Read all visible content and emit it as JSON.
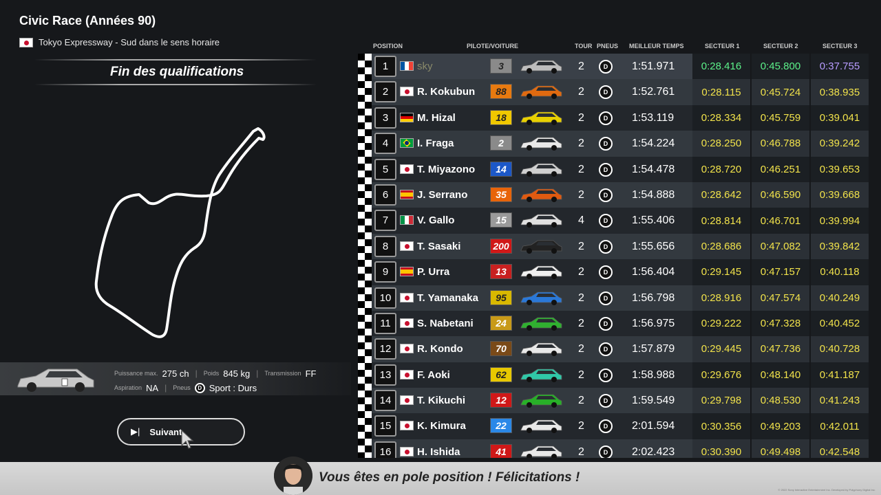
{
  "race": {
    "title": "Civic Race (Années 90)",
    "track": "Tokyo Expressway - Sud dans le sens horaire",
    "session": "Fin des qualifications"
  },
  "car_specs": {
    "power_label": "Puissance max.",
    "power_value": "275 ch",
    "weight_label": "Poids",
    "weight_value": "845 kg",
    "transmission_label": "Transmission",
    "transmission_value": "FF",
    "aspiration_label": "Aspiration",
    "aspiration_value": "NA",
    "tyres_label": "Pneus",
    "tyres_icon_letter": "D",
    "tyres_value": "Sport : Durs"
  },
  "next_button": {
    "icon": "▶|",
    "label": "Suivant"
  },
  "table": {
    "headers": {
      "position": "POSITION",
      "driver": "PILOTE/VOITURE",
      "lap": "TOUR",
      "tyres": "PNEUS",
      "best": "MEILLEUR TEMPS",
      "s1": "SECTEUR 1",
      "s2": "SECTEUR 2",
      "s3": "SECTEUR 3"
    },
    "rows": [
      {
        "pos": "1",
        "flag": "fr",
        "driver": "sky",
        "num": "3",
        "num_bg": "#8a8a8a",
        "num_fg": "#222",
        "car_color": "#bdbdbd",
        "lap": "2",
        "tyre": "D",
        "best": "1:51.971",
        "s1": "0:28.416",
        "s2": "0:45.800",
        "s3": "0:37.755",
        "s1c": "#5cf28a",
        "s2c": "#5cf28a",
        "s3c": "#b89cff",
        "me": true
      },
      {
        "pos": "2",
        "flag": "jp",
        "driver": "R. Kokubun",
        "num": "88",
        "num_bg": "#e87a10",
        "num_fg": "#222",
        "car_color": "#e06a10",
        "lap": "2",
        "tyre": "D",
        "best": "1:52.761",
        "s1": "0:28.115",
        "s2": "0:45.724",
        "s3": "0:38.935"
      },
      {
        "pos": "3",
        "flag": "de",
        "driver": "M. Hizal",
        "num": "18",
        "num_bg": "#f0c800",
        "num_fg": "#222",
        "car_color": "#e8d000",
        "lap": "2",
        "tyre": "D",
        "best": "1:53.119",
        "s1": "0:28.334",
        "s2": "0:45.759",
        "s3": "0:39.041"
      },
      {
        "pos": "4",
        "flag": "br",
        "driver": "I. Fraga",
        "num": "2",
        "num_bg": "#8a8a8a",
        "num_fg": "#fff",
        "car_color": "#e8e8e8",
        "lap": "2",
        "tyre": "D",
        "best": "1:54.224",
        "s1": "0:28.250",
        "s2": "0:46.788",
        "s3": "0:39.242"
      },
      {
        "pos": "5",
        "flag": "jp",
        "driver": "T. Miyazono",
        "num": "14",
        "num_bg": "#1c58c8",
        "num_fg": "#fff",
        "car_color": "#d0d0d0",
        "lap": "2",
        "tyre": "D",
        "best": "1:54.478",
        "s1": "0:28.720",
        "s2": "0:46.251",
        "s3": "0:39.653"
      },
      {
        "pos": "6",
        "flag": "es",
        "driver": "J. Serrano",
        "num": "35",
        "num_bg": "#e8640a",
        "num_fg": "#fff",
        "car_color": "#e05a10",
        "lap": "2",
        "tyre": "D",
        "best": "1:54.888",
        "s1": "0:28.642",
        "s2": "0:46.590",
        "s3": "0:39.668"
      },
      {
        "pos": "7",
        "flag": "it",
        "driver": "V. Gallo",
        "num": "15",
        "num_bg": "#9a9a9a",
        "num_fg": "#fff",
        "car_color": "#e0e0e0",
        "lap": "4",
        "tyre": "D",
        "best": "1:55.406",
        "s1": "0:28.814",
        "s2": "0:46.701",
        "s3": "0:39.994"
      },
      {
        "pos": "8",
        "flag": "jp",
        "driver": "T. Sasaki",
        "num": "200",
        "num_bg": "#d01818",
        "num_fg": "#fff",
        "car_color": "#222222",
        "lap": "2",
        "tyre": "D",
        "best": "1:55.656",
        "s1": "0:28.686",
        "s2": "0:47.082",
        "s3": "0:39.842"
      },
      {
        "pos": "9",
        "flag": "es",
        "driver": "P. Urra",
        "num": "13",
        "num_bg": "#c82020",
        "num_fg": "#fff",
        "car_color": "#f0f0f0",
        "lap": "2",
        "tyre": "D",
        "best": "1:56.404",
        "s1": "0:29.145",
        "s2": "0:47.157",
        "s3": "0:40.118"
      },
      {
        "pos": "10",
        "flag": "jp",
        "driver": "T. Yamanaka",
        "num": "95",
        "num_bg": "#d8b800",
        "num_fg": "#222",
        "car_color": "#2a78d8",
        "lap": "2",
        "tyre": "D",
        "best": "1:56.798",
        "s1": "0:28.916",
        "s2": "0:47.574",
        "s3": "0:40.249"
      },
      {
        "pos": "11",
        "flag": "jp",
        "driver": "S. Nabetani",
        "num": "24",
        "num_bg": "#c89a18",
        "num_fg": "#fff",
        "car_color": "#30b030",
        "lap": "2",
        "tyre": "D",
        "best": "1:56.975",
        "s1": "0:29.222",
        "s2": "0:47.328",
        "s3": "0:40.452"
      },
      {
        "pos": "12",
        "flag": "jp",
        "driver": "R. Kondo",
        "num": "70",
        "num_bg": "#7a4a18",
        "num_fg": "#fff",
        "car_color": "#e8e8e8",
        "lap": "2",
        "tyre": "D",
        "best": "1:57.879",
        "s1": "0:29.445",
        "s2": "0:47.736",
        "s3": "0:40.728"
      },
      {
        "pos": "13",
        "flag": "jp",
        "driver": "F. Aoki",
        "num": "62",
        "num_bg": "#e8c800",
        "num_fg": "#222",
        "car_color": "#30c8a8",
        "lap": "2",
        "tyre": "D",
        "best": "1:58.988",
        "s1": "0:29.676",
        "s2": "0:48.140",
        "s3": "0:41.187"
      },
      {
        "pos": "14",
        "flag": "jp",
        "driver": "T. Kikuchi",
        "num": "12",
        "num_bg": "#d01818",
        "num_fg": "#fff",
        "car_color": "#28b028",
        "lap": "2",
        "tyre": "D",
        "best": "1:59.549",
        "s1": "0:29.798",
        "s2": "0:48.530",
        "s3": "0:41.243"
      },
      {
        "pos": "15",
        "flag": "jp",
        "driver": "K. Kimura",
        "num": "22",
        "num_bg": "#2a88e8",
        "num_fg": "#fff",
        "car_color": "#e8e8e8",
        "lap": "2",
        "tyre": "D",
        "best": "2:01.594",
        "s1": "0:30.356",
        "s2": "0:49.203",
        "s3": "0:42.011"
      },
      {
        "pos": "16",
        "flag": "jp",
        "driver": "H. Ishida",
        "num": "41",
        "num_bg": "#d01818",
        "num_fg": "#fff",
        "car_color": "#e8e8e8",
        "lap": "2",
        "tyre": "D",
        "best": "2:02.423",
        "s1": "0:30.390",
        "s2": "0:49.498",
        "s3": "0:42.548"
      }
    ]
  },
  "message": "Vous êtes en pole position ! Félicitations !",
  "copyright": "© 2022 Sony Interactive Entertainment Inc. Developed by Polyphony Digital Inc.",
  "colors": {
    "sector_default": "#f2e34b",
    "personal_best": "#5cf28a",
    "overall_best": "#b89cff"
  }
}
